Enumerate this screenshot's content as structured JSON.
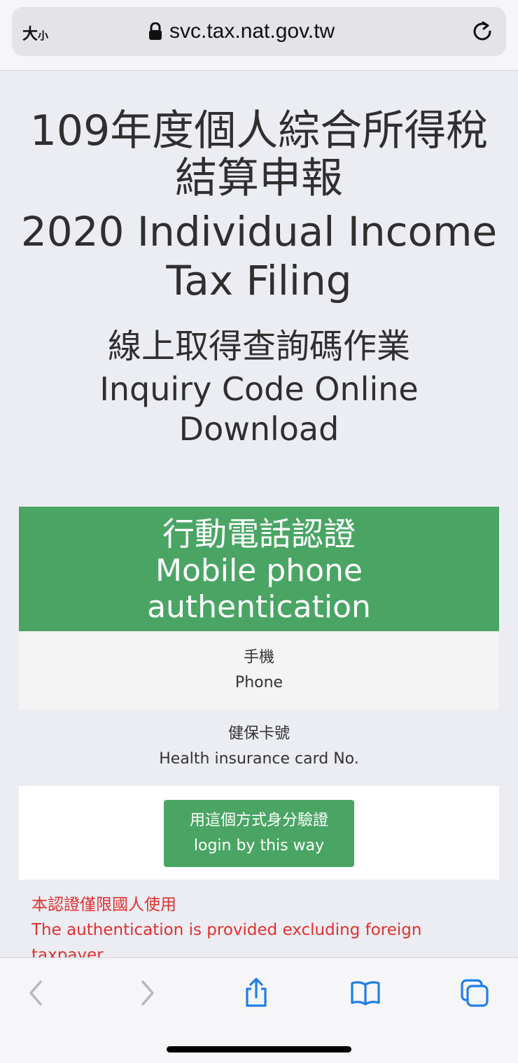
{
  "browser": {
    "text_size_big": "大",
    "text_size_small": "小",
    "url": "svc.tax.nat.gov.tw",
    "accent_color": "#1f7ee8"
  },
  "page": {
    "title_zh_line1": "109年度個人綜合所得稅",
    "title_zh_line2": "結算申報",
    "title_en_line1": "2020 Individual Income",
    "title_en_line2": "Tax Filing",
    "subtitle_zh": "線上取得查詢碼作業",
    "subtitle_en_line1": "Inquiry Code Online",
    "subtitle_en_line2": "Download"
  },
  "auth": {
    "header_zh": "行動電話認證",
    "header_en_line1": "Mobile phone",
    "header_en_line2": "authentication",
    "header_color": "#4aa564",
    "phone_label_zh": "手機",
    "phone_label_en": "Phone",
    "health_label_zh": "健保卡號",
    "health_label_en": "Health insurance card No.",
    "button_zh": "用這個方式身分驗證",
    "button_en": "login by this way"
  },
  "notice": {
    "line_zh": "本認證僅限國人使用",
    "line_en": "The authentication is provided excluding foreign taxpayer",
    "color": "#e0302f"
  },
  "toolbar": {
    "icons": [
      "back-icon",
      "forward-icon",
      "share-icon",
      "bookmarks-icon",
      "tabs-icon"
    ]
  }
}
